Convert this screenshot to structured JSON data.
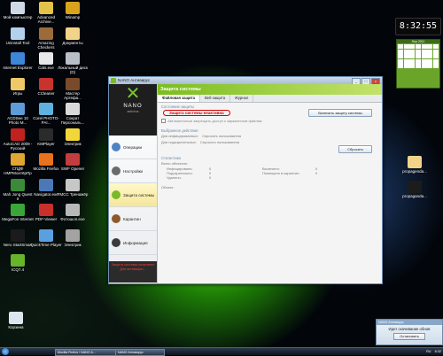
{
  "desktop_icons": [
    {
      "label": "Мой компьютер",
      "color": "#cfd9e6"
    },
    {
      "label": "Advanced Archive...",
      "color": "#e3c24a"
    },
    {
      "label": "Winamp",
      "color": "#d9a41d"
    },
    {
      "label": "Uninstall Tool",
      "color": "#b2d1ef"
    },
    {
      "label": "Amazing Checkers",
      "color": "#9b6b3a"
    },
    {
      "label": "Документы",
      "color": "#f2d38a"
    },
    {
      "label": "Internet Explorer",
      "color": "#3d86d8"
    },
    {
      "label": "Cats.exe",
      "color": "#e8e8e8"
    },
    {
      "label": "Локальный диск (D)",
      "color": "#b9bfc6"
    },
    {
      "label": "Игры",
      "color": "#f0c868"
    },
    {
      "label": "CCleaner",
      "color": "#c8332c"
    },
    {
      "label": "Мастер Артефа...",
      "color": "#7a4b2a"
    },
    {
      "label": "ACDSee 10 Photo M...",
      "color": "#5e9bd7"
    },
    {
      "label": "Corel PHOTO-PAI...",
      "color": "#5fb1de"
    },
    {
      "label": "Сократ Персональ...",
      "color": "#d9d9d9"
    },
    {
      "label": "AutoCAD 2009 - Русский",
      "color": "#c0231f"
    },
    {
      "label": "KMPlayer",
      "color": "#2b2b2b"
    },
    {
      "label": "Электрик",
      "color": "#f2d73a"
    },
    {
      "label": "СПДФ НМРМонтёрПр",
      "color": "#e0a533"
    },
    {
      "label": "Mozilla Firefox",
      "color": "#e8731c"
    },
    {
      "label": "SWF Opener",
      "color": "#c23d3d"
    },
    {
      "label": "Mah Jong Quest II",
      "color": "#3a8a3a"
    },
    {
      "label": "Navigator.exe",
      "color": "#4a79b8"
    },
    {
      "label": "TMCC Тренажёр",
      "color": "#c7c7c7"
    },
    {
      "label": "MegaFon Internet",
      "color": "#3aa63a"
    },
    {
      "label": "PDF-Viewer",
      "color": "#c9302c"
    },
    {
      "label": "Фотошоп.exe",
      "color": "#b8b8b8"
    },
    {
      "label": "Nero StartSmart",
      "color": "#1b1b1b"
    },
    {
      "label": "QuickTime Player",
      "color": "#5aa0e0"
    },
    {
      "label": "Электрик",
      "color": "#a3a3a3"
    },
    {
      "label": "ICQ7.4",
      "color": "#66b52a"
    }
  ],
  "desktop_right": [
    {
      "label": "propagenda...",
      "color": "#f2d38a"
    },
    {
      "label": "propaganda...",
      "color": "#1c1c1c"
    }
  ],
  "recycle": {
    "label": "Корзина",
    "color": "#dce6ee"
  },
  "clock": {
    "time": "8:32:55"
  },
  "calendar": {
    "header": "Sep 2011"
  },
  "window": {
    "title": "NANO Антивирус",
    "controls": {
      "min": "_",
      "max": "□",
      "close": "x"
    },
    "logo": {
      "word": "NANO",
      "sub": "antivirus"
    },
    "nav": [
      {
        "label": "Операции",
        "color": "#4d83c4"
      },
      {
        "label": "Настройки",
        "color": "#6a6a6a"
      },
      {
        "label": "Защита системы",
        "color": "#7ab928"
      },
      {
        "label": "Карантин",
        "color": "#8c5a2e"
      },
      {
        "label": "Информация",
        "color": "#3b3b3b"
      }
    ],
    "side_warning": "Защита системы неактивна Для активации...",
    "banner": "Защита системы",
    "tabs": [
      "Файловая защита",
      "Веб-защита",
      "Журнал"
    ],
    "state_header": "Состояние защиты",
    "status_text": "Защита системы неактивна",
    "enable_button": "Включить защиту системы",
    "auto_block": "Автоматически запрещать доступ к зараженным файлам",
    "actions_header": "Выбранное действие:",
    "action_infected_label": "Для инфицированных:",
    "action_infected_value": "Спросить пользователя",
    "action_suspicious_label": "Для подозрительных:",
    "action_suspicious_value": "Спросить пользователя",
    "reset_button": "Сбросить",
    "stats_header": "Статистика",
    "total_objects": "Всего объектов:",
    "stats_left": [
      {
        "label": "Инфицировано:",
        "value": "0"
      },
      {
        "label": "Подозрительно:",
        "value": "0"
      },
      {
        "label": "Удалено:",
        "value": "0"
      }
    ],
    "stats_right": [
      {
        "label": "Вылечено:",
        "value": "0"
      },
      {
        "label": "Помещено в карантин:",
        "value": "0"
      }
    ],
    "object_label": "Объект:"
  },
  "taskbar": {
    "tasks": [
      "Mozilla Firefox \\ NANO А...",
      "NANO Антивирус"
    ],
    "tray_lang": "RU",
    "tray_time": "8:32"
  },
  "notification": {
    "title": "NANO Антивирус",
    "message": "Идет скачивание обнов",
    "button": "Остановить"
  }
}
